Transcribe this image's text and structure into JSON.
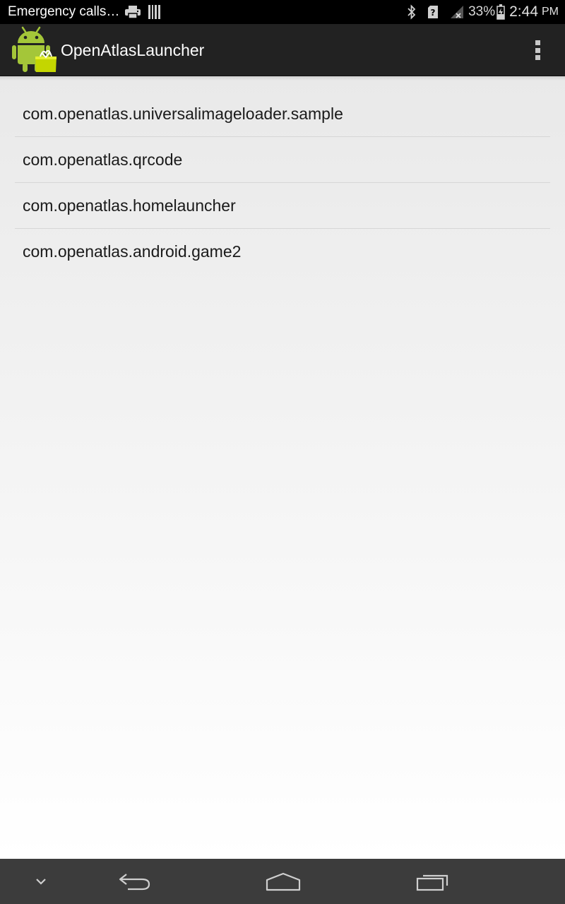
{
  "status_bar": {
    "carrier_text": "Emergency calls…",
    "battery_percent": "33%",
    "time": "2:44",
    "ampm": "PM",
    "left_icons": [
      "printer-icon",
      "barcode-icon"
    ],
    "right_icons": [
      "bluetooth-icon",
      "sim-unknown-icon",
      "signal-no-service-icon",
      "battery-charging-icon"
    ]
  },
  "action_bar": {
    "title": "OpenAtlasLauncher",
    "icon": "android-launcher-icon",
    "overflow_icon": "overflow-menu-icon"
  },
  "app_list": {
    "items": [
      {
        "label": "com.openatlas.universalimageloader.sample"
      },
      {
        "label": "com.openatlas.qrcode"
      },
      {
        "label": "com.openatlas.homelauncher"
      },
      {
        "label": "com.openatlas.android.game2"
      }
    ]
  },
  "nav_bar": {
    "icons": [
      "hide-keyboard-icon",
      "back-icon",
      "home-icon",
      "recents-icon"
    ]
  },
  "colors": {
    "status_bar_bg": "#000000",
    "action_bar_bg": "#222222",
    "nav_bar_bg": "#3c3c3c",
    "android_green": "#a4c639",
    "divider": "#d6d6d6"
  }
}
